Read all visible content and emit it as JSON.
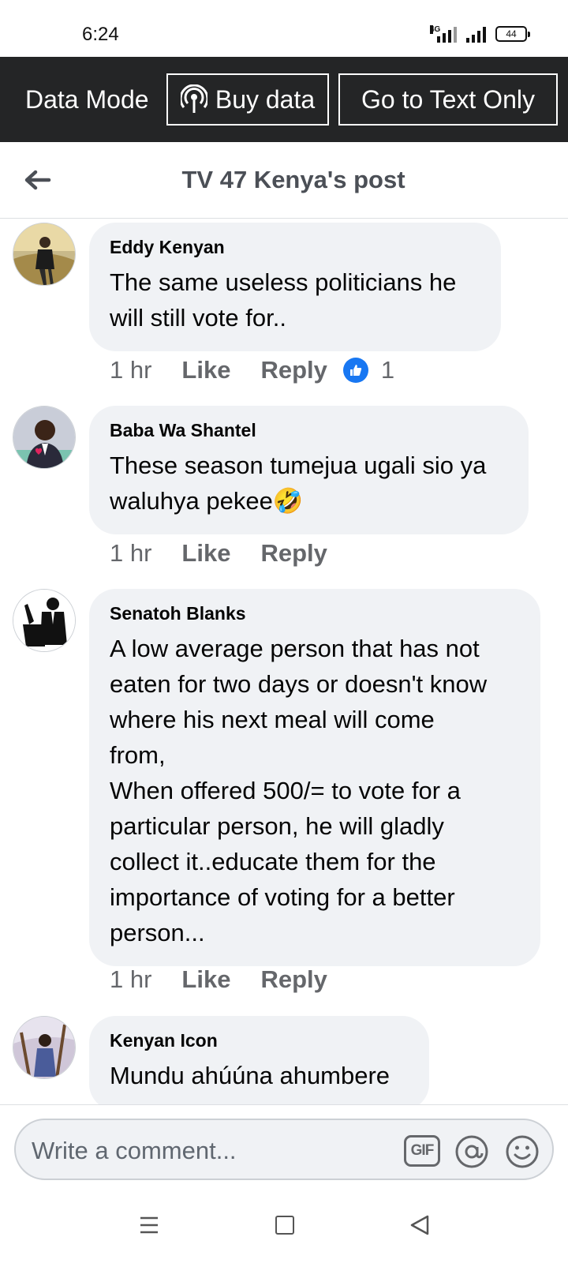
{
  "status_bar": {
    "time": "6:24",
    "network": "4G",
    "battery": "44"
  },
  "data_bar": {
    "mode_label": "Data Mode",
    "buy_data": "Buy data",
    "text_only": "Go to Text Only"
  },
  "header": {
    "title": "TV 47 Kenya's post"
  },
  "comments": [
    {
      "author": "Eddy Kenyan",
      "text": "The same useless politicians he\nwill still vote for..",
      "time": "1 hr",
      "like": "Like",
      "reply": "Reply",
      "reaction_count": "1"
    },
    {
      "author": "Baba Wa Shantel",
      "text": "These season tumejua ugali sio ya\nwaluhya pekee",
      "emoji": "🤣",
      "time": "1 hr",
      "like": "Like",
      "reply": "Reply"
    },
    {
      "author": "Senatoh Blanks",
      "text": "A low average person that has not\neaten for two days or doesn't know\nwhere his next meal will come\nfrom,\nWhen offered 500/= to vote for a\nparticular person, he will gladly\ncollect it..educate them for the\nimportance of voting for a better\nperson...",
      "time": "1 hr",
      "like": "Like",
      "reply": "Reply"
    },
    {
      "author": "Kenyan Icon",
      "text": "Mundu ahúúna ahumbere"
    }
  ],
  "composer": {
    "placeholder": "Write a comment...",
    "gif_label": "GIF"
  },
  "colors": {
    "data_bar_bg": "#242526",
    "bubble_bg": "#f0f2f5",
    "like_blue": "#1877f2",
    "meta_gray": "#65676b"
  }
}
